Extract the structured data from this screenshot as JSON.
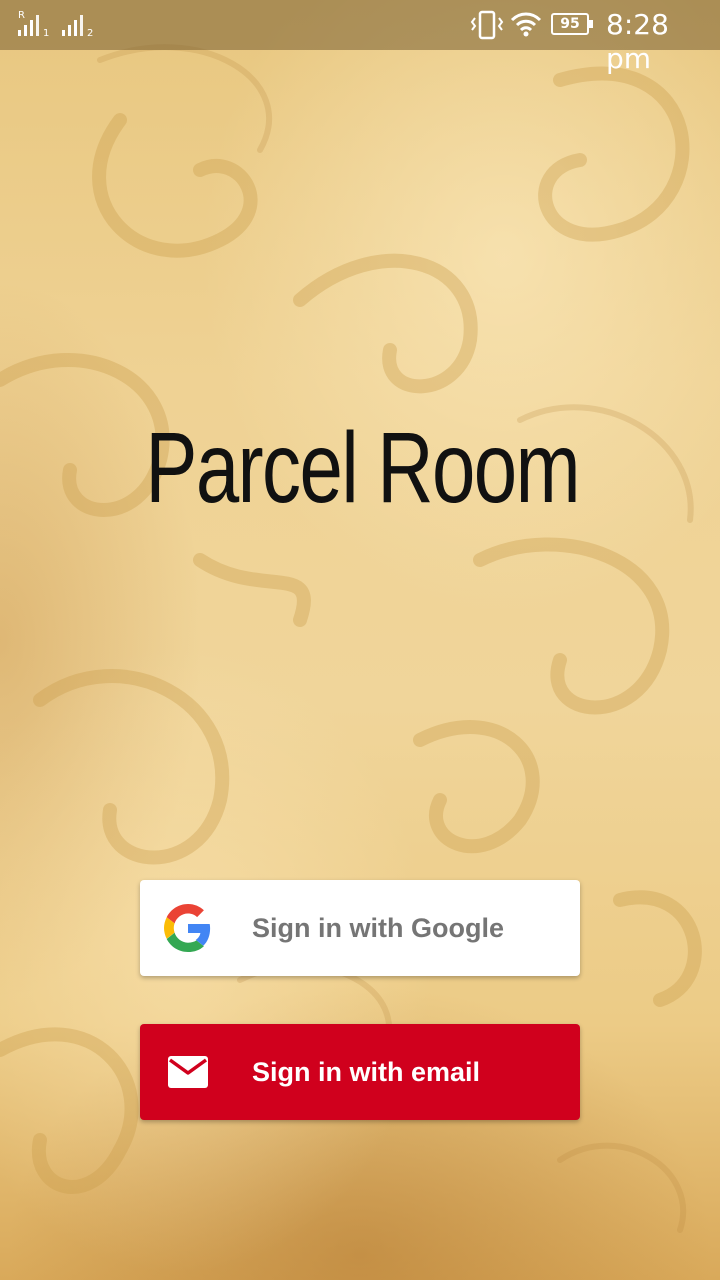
{
  "status_bar": {
    "sim1_label": "R",
    "sim1_index": "1",
    "sim2_index": "2",
    "battery_level": "95",
    "time": "8:28 pm",
    "icons": [
      "signal-icon",
      "signal-icon",
      "vibrate-icon",
      "wifi-icon",
      "battery-icon"
    ]
  },
  "app": {
    "title": "Parcel Room"
  },
  "auth": {
    "google_label": "Sign in with Google",
    "email_label": "Sign in with email"
  },
  "colors": {
    "email_button": "#d0001d",
    "google_button": "#ffffff",
    "google_text": "#757575",
    "background": "#efd294"
  }
}
